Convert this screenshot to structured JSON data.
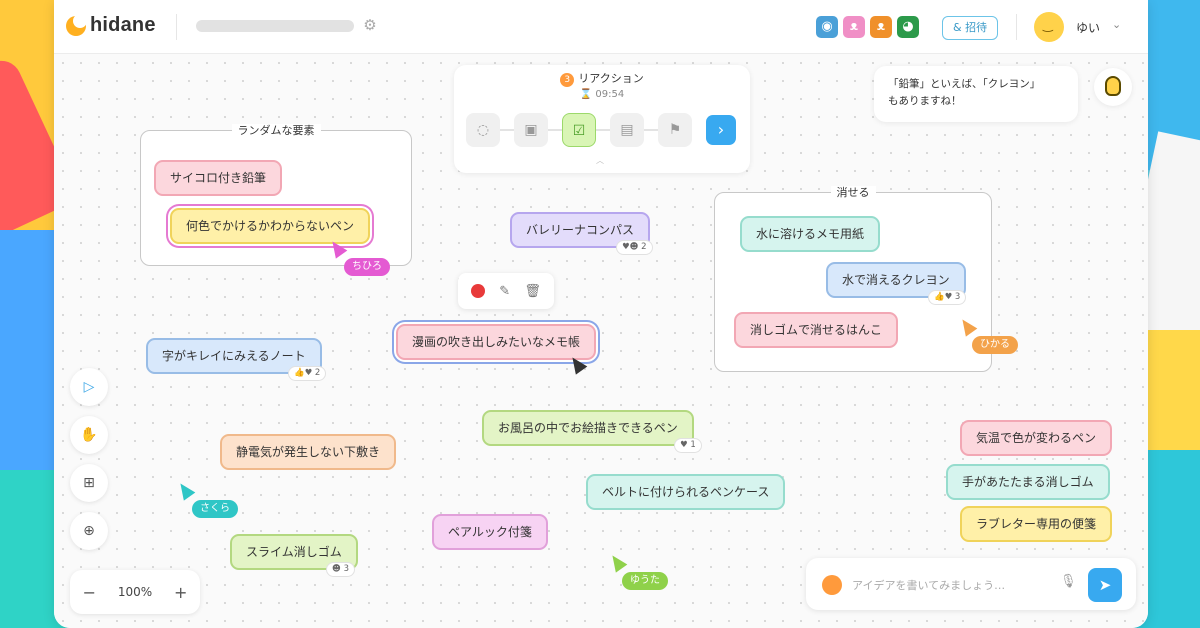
{
  "app": {
    "logo": "hidane",
    "gear_icon": "gear-icon"
  },
  "header": {
    "members": [
      {
        "icon": "penguin-avatar",
        "color": "#4aa0d8",
        "glyph": "◉"
      },
      {
        "icon": "rabbit-avatar",
        "color": "#f08fc6",
        "glyph": "ᴥ"
      },
      {
        "icon": "bear-avatar",
        "color": "#f0902a",
        "glyph": "ᴥ"
      },
      {
        "icon": "panda-avatar",
        "color": "#2c9a4a",
        "glyph": "◕"
      }
    ],
    "invite_label": "& 招待",
    "user_name": "ゆい",
    "user_caret": "⌄"
  },
  "reaction_panel": {
    "step_number": "3",
    "title": "リアクション",
    "timer": "⌛ 09:54",
    "steps": [
      "bulb-step-icon",
      "frame-step-icon",
      "reaction-step-icon",
      "chat-step-icon",
      "flag-step-icon"
    ],
    "next_label": "›"
  },
  "suggestion": {
    "line1": "「鉛筆」といえば、「クレヨン」",
    "line2": "もありますね！"
  },
  "groups": [
    {
      "title": "ランダムな要素"
    },
    {
      "title": "消せる"
    }
  ],
  "notes": {
    "n1": "サイコロ付き鉛筆",
    "n2": "何色でかけるかわからないペン",
    "n3": "バレリーナコンパス",
    "n4": "水に溶けるメモ用紙",
    "n5": "水で消えるクレヨン",
    "n6": "消しゴムで消せるはんこ",
    "n7": "漫画の吹き出しみたいなメモ帳",
    "n8": "字がキレイにみえるノート",
    "n9": "お風呂の中でお絵描きできるペン",
    "n10": "静電気が発生しない下敷き",
    "n11": "ベルトに付けられるペンケース",
    "n12": "気温で色が変わるペン",
    "n13": "手があたたまる消しゴム",
    "n14": "ラブレター専用の便箋",
    "n15": "ペアルック付箋",
    "n16": "スライム消しゴム"
  },
  "reactions": {
    "r3": "♥☻ 2",
    "r5": "👍♥ 3",
    "r8": "👍♥ 2",
    "r9": "♥ 1",
    "r16": "☻ 3"
  },
  "cursors": [
    {
      "name": "ちひろ",
      "color": "#e45ad2"
    },
    {
      "name": "ひかる",
      "color": "#f3a24a"
    },
    {
      "name": "さくら",
      "color": "#2fc6c6"
    },
    {
      "name": "ゆうた",
      "color": "#8fd14a"
    }
  ],
  "tools": [
    "select-tool-icon",
    "hand-tool-icon",
    "add-frame-icon",
    "add-note-icon"
  ],
  "zoom": {
    "minus": "−",
    "level": "100%",
    "plus": "+"
  },
  "idea_input": {
    "placeholder": "アイデアを書いてみましょう…",
    "value": ""
  }
}
